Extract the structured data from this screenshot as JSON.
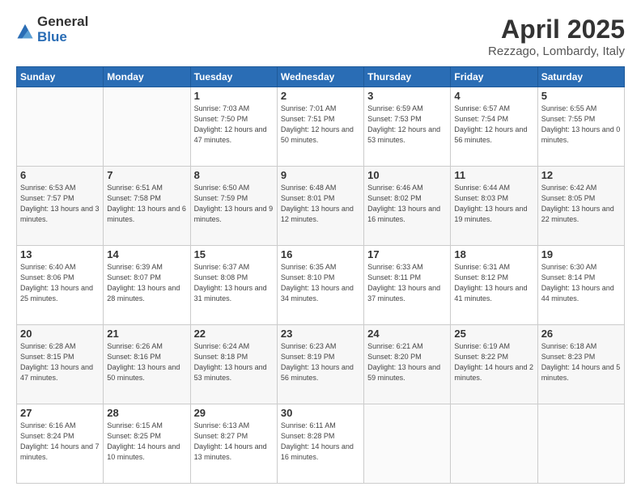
{
  "header": {
    "logo_general": "General",
    "logo_blue": "Blue",
    "title": "April 2025",
    "location": "Rezzago, Lombardy, Italy"
  },
  "weekdays": [
    "Sunday",
    "Monday",
    "Tuesday",
    "Wednesday",
    "Thursday",
    "Friday",
    "Saturday"
  ],
  "weeks": [
    [
      {
        "day": "",
        "info": ""
      },
      {
        "day": "",
        "info": ""
      },
      {
        "day": "1",
        "info": "Sunrise: 7:03 AM\nSunset: 7:50 PM\nDaylight: 12 hours and 47 minutes."
      },
      {
        "day": "2",
        "info": "Sunrise: 7:01 AM\nSunset: 7:51 PM\nDaylight: 12 hours and 50 minutes."
      },
      {
        "day": "3",
        "info": "Sunrise: 6:59 AM\nSunset: 7:53 PM\nDaylight: 12 hours and 53 minutes."
      },
      {
        "day": "4",
        "info": "Sunrise: 6:57 AM\nSunset: 7:54 PM\nDaylight: 12 hours and 56 minutes."
      },
      {
        "day": "5",
        "info": "Sunrise: 6:55 AM\nSunset: 7:55 PM\nDaylight: 13 hours and 0 minutes."
      }
    ],
    [
      {
        "day": "6",
        "info": "Sunrise: 6:53 AM\nSunset: 7:57 PM\nDaylight: 13 hours and 3 minutes."
      },
      {
        "day": "7",
        "info": "Sunrise: 6:51 AM\nSunset: 7:58 PM\nDaylight: 13 hours and 6 minutes."
      },
      {
        "day": "8",
        "info": "Sunrise: 6:50 AM\nSunset: 7:59 PM\nDaylight: 13 hours and 9 minutes."
      },
      {
        "day": "9",
        "info": "Sunrise: 6:48 AM\nSunset: 8:01 PM\nDaylight: 13 hours and 12 minutes."
      },
      {
        "day": "10",
        "info": "Sunrise: 6:46 AM\nSunset: 8:02 PM\nDaylight: 13 hours and 16 minutes."
      },
      {
        "day": "11",
        "info": "Sunrise: 6:44 AM\nSunset: 8:03 PM\nDaylight: 13 hours and 19 minutes."
      },
      {
        "day": "12",
        "info": "Sunrise: 6:42 AM\nSunset: 8:05 PM\nDaylight: 13 hours and 22 minutes."
      }
    ],
    [
      {
        "day": "13",
        "info": "Sunrise: 6:40 AM\nSunset: 8:06 PM\nDaylight: 13 hours and 25 minutes."
      },
      {
        "day": "14",
        "info": "Sunrise: 6:39 AM\nSunset: 8:07 PM\nDaylight: 13 hours and 28 minutes."
      },
      {
        "day": "15",
        "info": "Sunrise: 6:37 AM\nSunset: 8:08 PM\nDaylight: 13 hours and 31 minutes."
      },
      {
        "day": "16",
        "info": "Sunrise: 6:35 AM\nSunset: 8:10 PM\nDaylight: 13 hours and 34 minutes."
      },
      {
        "day": "17",
        "info": "Sunrise: 6:33 AM\nSunset: 8:11 PM\nDaylight: 13 hours and 37 minutes."
      },
      {
        "day": "18",
        "info": "Sunrise: 6:31 AM\nSunset: 8:12 PM\nDaylight: 13 hours and 41 minutes."
      },
      {
        "day": "19",
        "info": "Sunrise: 6:30 AM\nSunset: 8:14 PM\nDaylight: 13 hours and 44 minutes."
      }
    ],
    [
      {
        "day": "20",
        "info": "Sunrise: 6:28 AM\nSunset: 8:15 PM\nDaylight: 13 hours and 47 minutes."
      },
      {
        "day": "21",
        "info": "Sunrise: 6:26 AM\nSunset: 8:16 PM\nDaylight: 13 hours and 50 minutes."
      },
      {
        "day": "22",
        "info": "Sunrise: 6:24 AM\nSunset: 8:18 PM\nDaylight: 13 hours and 53 minutes."
      },
      {
        "day": "23",
        "info": "Sunrise: 6:23 AM\nSunset: 8:19 PM\nDaylight: 13 hours and 56 minutes."
      },
      {
        "day": "24",
        "info": "Sunrise: 6:21 AM\nSunset: 8:20 PM\nDaylight: 13 hours and 59 minutes."
      },
      {
        "day": "25",
        "info": "Sunrise: 6:19 AM\nSunset: 8:22 PM\nDaylight: 14 hours and 2 minutes."
      },
      {
        "day": "26",
        "info": "Sunrise: 6:18 AM\nSunset: 8:23 PM\nDaylight: 14 hours and 5 minutes."
      }
    ],
    [
      {
        "day": "27",
        "info": "Sunrise: 6:16 AM\nSunset: 8:24 PM\nDaylight: 14 hours and 7 minutes."
      },
      {
        "day": "28",
        "info": "Sunrise: 6:15 AM\nSunset: 8:25 PM\nDaylight: 14 hours and 10 minutes."
      },
      {
        "day": "29",
        "info": "Sunrise: 6:13 AM\nSunset: 8:27 PM\nDaylight: 14 hours and 13 minutes."
      },
      {
        "day": "30",
        "info": "Sunrise: 6:11 AM\nSunset: 8:28 PM\nDaylight: 14 hours and 16 minutes."
      },
      {
        "day": "",
        "info": ""
      },
      {
        "day": "",
        "info": ""
      },
      {
        "day": "",
        "info": ""
      }
    ]
  ]
}
